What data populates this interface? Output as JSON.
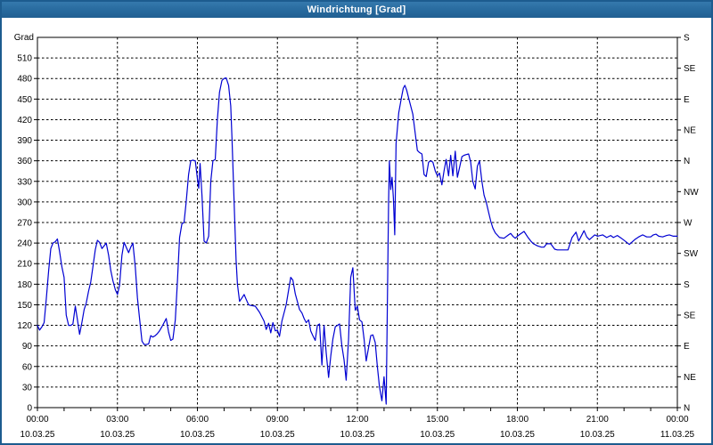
{
  "window": {
    "title": "Windrichtung [Grad]"
  },
  "colors": {
    "titlebar": "#26689c",
    "window_border": "#1d5c8f",
    "background": "#ffffff",
    "grid": "#000000",
    "axis": "#000000",
    "text": "#000000",
    "series_line": "#0000d2"
  },
  "chart_data": {
    "type": "line",
    "title": "Windrichtung [Grad]",
    "grid": "dashed",
    "legend": "none",
    "y_axis": {
      "label": "Grad",
      "min": 0,
      "max": 540,
      "tick_step": 30,
      "ticks": [
        0,
        30,
        60,
        90,
        120,
        150,
        180,
        210,
        240,
        270,
        300,
        330,
        360,
        390,
        420,
        450,
        480,
        510
      ]
    },
    "y2_axis": {
      "type": "compass",
      "tick_step_degrees": 45,
      "labels_bottom_to_top": [
        "N",
        "NE",
        "E",
        "SE",
        "S",
        "SW",
        "W",
        "NW",
        "N",
        "NE",
        "E",
        "SE",
        "S"
      ]
    },
    "x_axis": {
      "range_hours": [
        0,
        24
      ],
      "minor_tick_hours": 1,
      "major_ticks": [
        {
          "hour": 0,
          "time": "00:00",
          "date": "10.03.25"
        },
        {
          "hour": 3,
          "time": "03:00",
          "date": "10.03.25"
        },
        {
          "hour": 6,
          "time": "06:00",
          "date": "10.03.25"
        },
        {
          "hour": 9,
          "time": "09:00",
          "date": "10.03.25"
        },
        {
          "hour": 12,
          "time": "12:00",
          "date": "10.03.25"
        },
        {
          "hour": 15,
          "time": "15:00",
          "date": "10.03.25"
        },
        {
          "hour": 18,
          "time": "18:00",
          "date": "10.03.25"
        },
        {
          "hour": 21,
          "time": "21:00",
          "date": "10.03.25"
        },
        {
          "hour": 24,
          "time": "00:00",
          "date": "11.03.25"
        }
      ]
    },
    "series": [
      {
        "name": "Windrichtung",
        "color": "#0000d2",
        "points": [
          [
            0.0,
            120
          ],
          [
            0.08,
            113
          ],
          [
            0.17,
            118
          ],
          [
            0.25,
            124
          ],
          [
            0.33,
            158
          ],
          [
            0.42,
            200
          ],
          [
            0.5,
            232
          ],
          [
            0.58,
            240
          ],
          [
            0.67,
            242
          ],
          [
            0.75,
            246
          ],
          [
            0.83,
            228
          ],
          [
            0.92,
            205
          ],
          [
            1.0,
            190
          ],
          [
            1.08,
            135
          ],
          [
            1.17,
            120
          ],
          [
            1.25,
            120
          ],
          [
            1.33,
            122
          ],
          [
            1.42,
            148
          ],
          [
            1.5,
            128
          ],
          [
            1.58,
            107
          ],
          [
            1.67,
            125
          ],
          [
            1.75,
            143
          ],
          [
            1.83,
            152
          ],
          [
            1.92,
            170
          ],
          [
            2.0,
            183
          ],
          [
            2.08,
            205
          ],
          [
            2.17,
            230
          ],
          [
            2.25,
            244
          ],
          [
            2.33,
            241
          ],
          [
            2.42,
            232
          ],
          [
            2.5,
            236
          ],
          [
            2.58,
            240
          ],
          [
            2.67,
            222
          ],
          [
            2.75,
            200
          ],
          [
            2.83,
            185
          ],
          [
            2.92,
            172
          ],
          [
            3.0,
            165
          ],
          [
            3.08,
            178
          ],
          [
            3.17,
            222
          ],
          [
            3.25,
            241
          ],
          [
            3.33,
            234
          ],
          [
            3.42,
            226
          ],
          [
            3.5,
            234
          ],
          [
            3.58,
            240
          ],
          [
            3.67,
            205
          ],
          [
            3.75,
            160
          ],
          [
            3.83,
            130
          ],
          [
            3.92,
            97
          ],
          [
            4.0,
            92
          ],
          [
            4.08,
            92
          ],
          [
            4.17,
            93
          ],
          [
            4.25,
            105
          ],
          [
            4.33,
            103
          ],
          [
            4.42,
            105
          ],
          [
            4.5,
            108
          ],
          [
            4.58,
            112
          ],
          [
            4.67,
            118
          ],
          [
            4.75,
            124
          ],
          [
            4.83,
            130
          ],
          [
            4.92,
            110
          ],
          [
            5.0,
            98
          ],
          [
            5.08,
            100
          ],
          [
            5.17,
            128
          ],
          [
            5.25,
            185
          ],
          [
            5.33,
            248
          ],
          [
            5.42,
            268
          ],
          [
            5.5,
            270
          ],
          [
            5.58,
            300
          ],
          [
            5.67,
            340
          ],
          [
            5.75,
            360
          ],
          [
            5.83,
            361
          ],
          [
            5.92,
            360
          ],
          [
            6.0,
            334
          ],
          [
            6.05,
            320
          ],
          [
            6.1,
            356
          ],
          [
            6.17,
            310
          ],
          [
            6.25,
            243
          ],
          [
            6.33,
            240
          ],
          [
            6.42,
            250
          ],
          [
            6.5,
            330
          ],
          [
            6.58,
            360
          ],
          [
            6.67,
            362
          ],
          [
            6.75,
            420
          ],
          [
            6.83,
            460
          ],
          [
            6.92,
            477
          ],
          [
            7.0,
            480
          ],
          [
            7.08,
            481
          ],
          [
            7.17,
            470
          ],
          [
            7.25,
            440
          ],
          [
            7.3,
            389
          ],
          [
            7.35,
            330
          ],
          [
            7.4,
            272
          ],
          [
            7.45,
            215
          ],
          [
            7.5,
            180
          ],
          [
            7.58,
            155
          ],
          [
            7.67,
            160
          ],
          [
            7.75,
            165
          ],
          [
            7.83,
            158
          ],
          [
            7.92,
            150
          ],
          [
            8.0,
            149
          ],
          [
            8.17,
            148
          ],
          [
            8.33,
            139
          ],
          [
            8.5,
            126
          ],
          [
            8.58,
            114
          ],
          [
            8.67,
            123
          ],
          [
            8.75,
            109
          ],
          [
            8.83,
            124
          ],
          [
            8.92,
            112
          ],
          [
            9.0,
            113
          ],
          [
            9.08,
            104
          ],
          [
            9.17,
            126
          ],
          [
            9.33,
            150
          ],
          [
            9.5,
            190
          ],
          [
            9.58,
            186
          ],
          [
            9.67,
            166
          ],
          [
            9.83,
            143
          ],
          [
            9.92,
            138
          ],
          [
            10.0,
            130
          ],
          [
            10.08,
            124
          ],
          [
            10.17,
            128
          ],
          [
            10.25,
            112
          ],
          [
            10.33,
            105
          ],
          [
            10.42,
            98
          ],
          [
            10.5,
            120
          ],
          [
            10.58,
            122
          ],
          [
            10.67,
            62
          ],
          [
            10.75,
            120
          ],
          [
            10.83,
            80
          ],
          [
            10.92,
            44
          ],
          [
            11.0,
            75
          ],
          [
            11.08,
            100
          ],
          [
            11.17,
            118
          ],
          [
            11.25,
            120
          ],
          [
            11.33,
            122
          ],
          [
            11.42,
            90
          ],
          [
            11.5,
            70
          ],
          [
            11.58,
            40
          ],
          [
            11.67,
            100
          ],
          [
            11.75,
            190
          ],
          [
            11.83,
            204
          ],
          [
            11.92,
            142
          ],
          [
            12.0,
            148
          ],
          [
            12.08,
            128
          ],
          [
            12.17,
            125
          ],
          [
            12.25,
            100
          ],
          [
            12.33,
            68
          ],
          [
            12.42,
            88
          ],
          [
            12.5,
            105
          ],
          [
            12.58,
            106
          ],
          [
            12.67,
            95
          ],
          [
            12.75,
            60
          ],
          [
            12.83,
            30
          ],
          [
            12.92,
            10
          ],
          [
            13.0,
            45
          ],
          [
            13.08,
            5
          ],
          [
            13.17,
            300
          ],
          [
            13.2,
            360
          ],
          [
            13.25,
            318
          ],
          [
            13.3,
            336
          ],
          [
            13.35,
            305
          ],
          [
            13.4,
            252
          ],
          [
            13.45,
            385
          ],
          [
            13.55,
            430
          ],
          [
            13.65,
            452
          ],
          [
            13.72,
            466
          ],
          [
            13.78,
            470
          ],
          [
            13.85,
            463
          ],
          [
            13.92,
            452
          ],
          [
            14.0,
            440
          ],
          [
            14.08,
            428
          ],
          [
            14.17,
            400
          ],
          [
            14.25,
            375
          ],
          [
            14.33,
            372
          ],
          [
            14.42,
            370
          ],
          [
            14.5,
            340
          ],
          [
            14.58,
            337
          ],
          [
            14.67,
            358
          ],
          [
            14.75,
            360
          ],
          [
            14.83,
            358
          ],
          [
            14.92,
            345
          ],
          [
            15.0,
            338
          ],
          [
            15.08,
            342
          ],
          [
            15.17,
            325
          ],
          [
            15.25,
            345
          ],
          [
            15.33,
            362
          ],
          [
            15.42,
            338
          ],
          [
            15.5,
            368
          ],
          [
            15.58,
            338
          ],
          [
            15.67,
            374
          ],
          [
            15.75,
            336
          ],
          [
            15.83,
            350
          ],
          [
            15.92,
            366
          ],
          [
            16.0,
            368
          ],
          [
            16.08,
            369
          ],
          [
            16.17,
            370
          ],
          [
            16.25,
            358
          ],
          [
            16.33,
            330
          ],
          [
            16.42,
            319
          ],
          [
            16.5,
            352
          ],
          [
            16.58,
            360
          ],
          [
            16.67,
            330
          ],
          [
            16.75,
            310
          ],
          [
            16.83,
            300
          ],
          [
            16.92,
            285
          ],
          [
            17.0,
            272
          ],
          [
            17.08,
            262
          ],
          [
            17.17,
            255
          ],
          [
            17.33,
            248
          ],
          [
            17.5,
            247
          ],
          [
            17.67,
            252
          ],
          [
            17.75,
            254
          ],
          [
            17.83,
            250
          ],
          [
            17.92,
            247
          ],
          [
            18.0,
            250
          ],
          [
            18.1,
            253
          ],
          [
            18.25,
            257
          ],
          [
            18.4,
            248
          ],
          [
            18.5,
            243
          ],
          [
            18.6,
            239
          ],
          [
            18.75,
            236
          ],
          [
            18.9,
            234
          ],
          [
            19.0,
            234
          ],
          [
            19.1,
            239
          ],
          [
            19.25,
            239
          ],
          [
            19.4,
            231
          ],
          [
            19.5,
            230
          ],
          [
            19.75,
            230
          ],
          [
            19.9,
            230
          ],
          [
            20.05,
            248
          ],
          [
            20.2,
            256
          ],
          [
            20.3,
            243
          ],
          [
            20.5,
            258
          ],
          [
            20.6,
            249
          ],
          [
            20.7,
            245
          ],
          [
            20.9,
            252
          ],
          [
            21.0,
            250
          ],
          [
            21.2,
            252
          ],
          [
            21.35,
            248
          ],
          [
            21.5,
            251
          ],
          [
            21.6,
            248
          ],
          [
            21.75,
            251
          ],
          [
            21.9,
            247
          ],
          [
            22.1,
            241
          ],
          [
            22.2,
            238
          ],
          [
            22.4,
            245
          ],
          [
            22.55,
            249
          ],
          [
            22.7,
            252
          ],
          [
            22.85,
            249
          ],
          [
            23.0,
            249
          ],
          [
            23.1,
            252
          ],
          [
            23.2,
            253
          ],
          [
            23.3,
            250
          ],
          [
            23.45,
            249
          ],
          [
            23.6,
            251
          ],
          [
            23.7,
            252
          ],
          [
            23.85,
            250
          ],
          [
            24.0,
            250
          ]
        ]
      }
    ]
  }
}
